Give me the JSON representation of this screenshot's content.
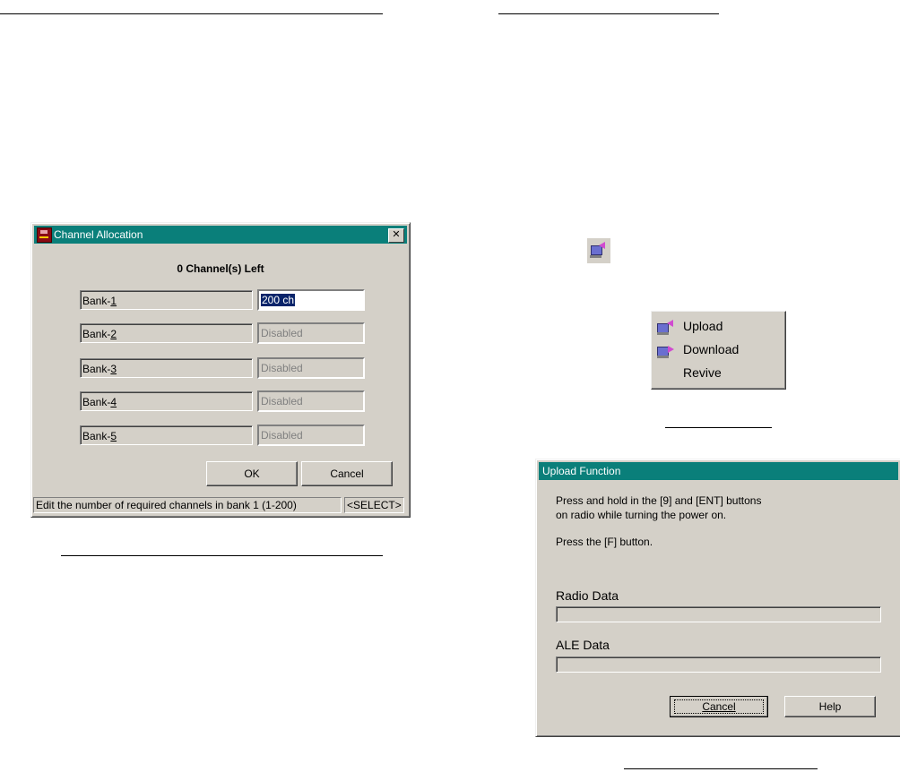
{
  "channel_dialog": {
    "title": "Channel Allocation",
    "close_glyph": "✕",
    "channels_left": "0 Channel(s) Left",
    "banks": [
      {
        "prefix": "Bank-",
        "number": "1",
        "value": "200 ch"
      },
      {
        "prefix": "Bank-",
        "number": "2",
        "value": "Disabled"
      },
      {
        "prefix": "Bank-",
        "number": "3",
        "value": "Disabled"
      },
      {
        "prefix": "Bank-",
        "number": "4",
        "value": "Disabled"
      },
      {
        "prefix": "Bank-",
        "number": "5",
        "value": "Disabled"
      }
    ],
    "ok_label": "OK",
    "cancel_label": "Cancel",
    "status_text": "Edit the number of required channels in bank 1 (1-200)",
    "status_mode": "<SELECT>"
  },
  "context_menu": {
    "items": [
      {
        "label": "Upload",
        "icon": "upload-icon"
      },
      {
        "label": "Download",
        "icon": "download-icon"
      },
      {
        "label": "Revive",
        "icon": ""
      }
    ]
  },
  "upload_dialog": {
    "title": "Upload Function",
    "instruction_line1": "Press and hold in the [9] and [ENT] buttons",
    "instruction_line2": "on radio while turning the power on.",
    "instruction_line3": "Press the [F] button.",
    "radio_data_label": "Radio Data",
    "radio_data_progress": 0,
    "ale_data_label": "ALE Data",
    "ale_data_progress": 0,
    "cancel_label": "Cancel",
    "help_label": "Help"
  },
  "colors": {
    "titlebar": "#0a7f7a",
    "dialog_face": "#d4d0c8",
    "selection": "#0a246a"
  }
}
